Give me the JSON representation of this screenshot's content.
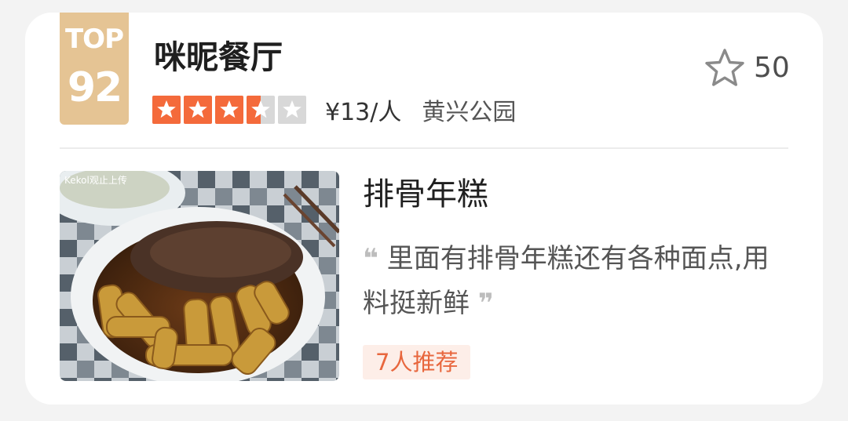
{
  "rank": {
    "top_label": "TOP",
    "number": "92"
  },
  "restaurant": {
    "name": "咪昵餐厅",
    "rating_stars": 3.5,
    "rating_max": 5,
    "price": "¥13/人",
    "area": "黄兴公园"
  },
  "favorite": {
    "icon": "star-outline-icon",
    "count": "50"
  },
  "dish": {
    "photo_watermark": "Kekol观止上传",
    "name": "排骨年糕",
    "review_open_quote": "❝",
    "review": "里面有排骨年糕还有各种面点,用料挺新鲜",
    "review_close_quote": "❞",
    "recommend": "7人推荐"
  },
  "colors": {
    "rank_badge": "#e5c494",
    "star_filled": "#f46a3b",
    "star_empty": "#d8d8d8",
    "recommend_text": "#e8673e",
    "recommend_bg": "#fdeee8"
  }
}
